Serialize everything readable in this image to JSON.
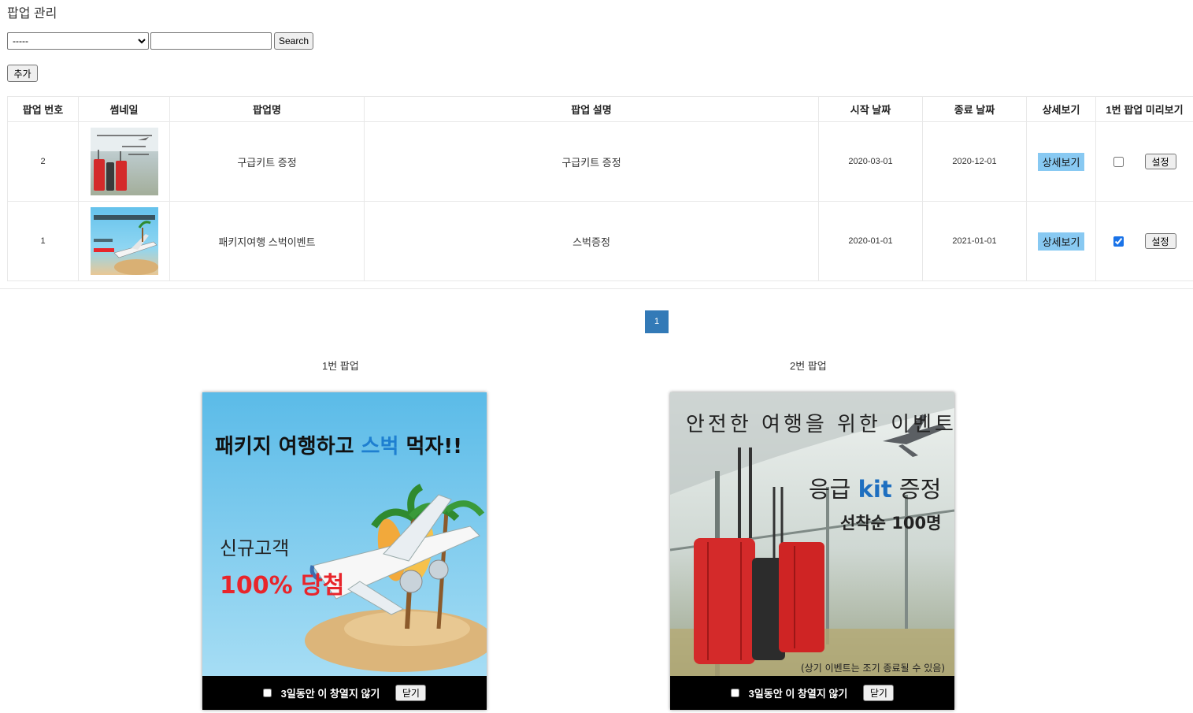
{
  "header": {
    "title": "팝업 관리"
  },
  "search": {
    "select_value": "-----",
    "input_value": "",
    "button_label": "Search"
  },
  "toolbar": {
    "add_label": "추가"
  },
  "table": {
    "headers": [
      "팝업 번호",
      "썸네일",
      "팝업명",
      "팝업 설명",
      "시작 날짜",
      "종료 날짜",
      "상세보기",
      "1번 팝업 미리보기"
    ],
    "rows": [
      {
        "num": "2",
        "thumb_icon": "suitcase-airport-thumbnail",
        "name": "구급키트 증정",
        "desc": "구급키트 증정",
        "start": "2020-03-01",
        "end": "2020-12-01",
        "detail_label": "상세보기",
        "preview_checked": false,
        "set_label": "설정"
      },
      {
        "num": "1",
        "thumb_icon": "beach-airplane-thumbnail",
        "name": "패키지여행 스벅이벤트",
        "desc": "스벅증정",
        "start": "2020-01-01",
        "end": "2021-01-01",
        "detail_label": "상세보기",
        "preview_checked": true,
        "set_label": "설정"
      }
    ]
  },
  "pagination": {
    "current": "1"
  },
  "popups": [
    {
      "label": "1번 팝업",
      "image": {
        "headline_a": "패키지 여행하고 ",
        "headline_b": "스벅",
        "headline_c": " 먹자!!",
        "line1": "신규고객",
        "line2": "100% 당첨"
      },
      "dont_show_label": "3일동안 이 창열지 않기",
      "close_label": "닫기"
    },
    {
      "label": "2번 팝업",
      "image": {
        "headline": "안전한 여행을 위한 이벤트",
        "line1_a": "응급 ",
        "line1_b": "kit",
        "line1_c": " 증정",
        "line2": "선착순 100명",
        "footnote": "(상기 이벤트는 조기 종료될 수 있음)"
      },
      "dont_show_label": "3일동안 이 창열지 않기",
      "close_label": "닫기"
    }
  ],
  "colors": {
    "accent": "#337ab7",
    "detail_button": "#88c9f2",
    "highlight_text": "#1e7fd0",
    "red_text": "#e8252b"
  }
}
